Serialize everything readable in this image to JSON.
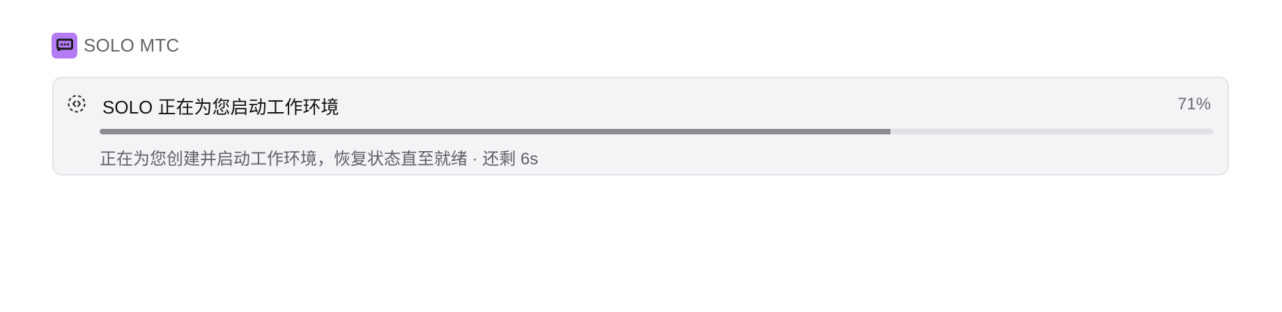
{
  "app": {
    "name": "SOLO MTC",
    "icon": "chat-bubble-icon",
    "accent_color": "#b57bf5"
  },
  "status_card": {
    "title": "SOLO 正在为您启动工作环境",
    "percent_label": "71%",
    "progress": 0.71,
    "description": "正在为您创建并启动工作环境，恢复状态直至就绪 · 还剩 6s",
    "spinner_icon": "loading-spinner-icon"
  }
}
